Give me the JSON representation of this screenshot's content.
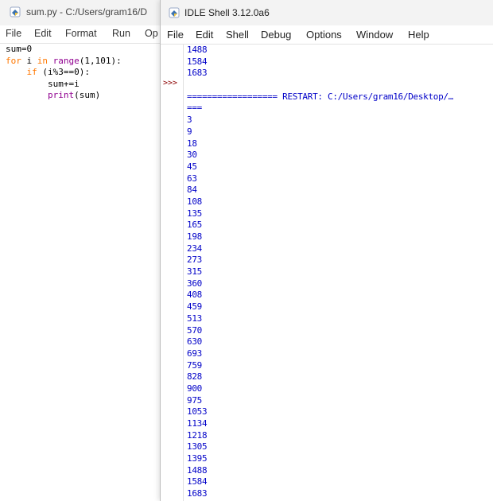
{
  "editor": {
    "title": "sum.py - C:/Users/gram16/D",
    "menu": [
      "File",
      "Edit",
      "Format",
      "Run",
      "Op"
    ],
    "code": [
      {
        "parts": [
          {
            "t": "sum=0",
            "c": "tx"
          }
        ]
      },
      {
        "parts": [
          {
            "t": "for",
            "c": "kw"
          },
          {
            "t": " i ",
            "c": "tx"
          },
          {
            "t": "in",
            "c": "kw"
          },
          {
            "t": " ",
            "c": "tx"
          },
          {
            "t": "range",
            "c": "bi"
          },
          {
            "t": "(1,101):",
            "c": "tx"
          }
        ]
      },
      {
        "parts": [
          {
            "t": "    ",
            "c": "tx"
          },
          {
            "t": "if",
            "c": "kw"
          },
          {
            "t": " (i%3==0):",
            "c": "tx"
          }
        ]
      },
      {
        "parts": [
          {
            "t": "        sum+=i",
            "c": "tx"
          }
        ]
      },
      {
        "parts": [
          {
            "t": "        ",
            "c": "tx"
          },
          {
            "t": "print",
            "c": "bi"
          },
          {
            "t": "(sum)",
            "c": "tx"
          }
        ]
      }
    ]
  },
  "shell": {
    "title": "IDLE Shell 3.12.0a6",
    "menu": [
      "File",
      "Edit",
      "Shell",
      "Debug",
      "Options",
      "Window",
      "Help"
    ],
    "prompt": ">>>",
    "output_top": [
      "1488",
      "1584",
      "1683",
      ""
    ],
    "restart_line": "================== RESTART: C:/Users/gram16/Desktop/…",
    "restart_cont": "===",
    "output": [
      "3",
      "9",
      "18",
      "30",
      "45",
      "63",
      "84",
      "108",
      "135",
      "165",
      "198",
      "234",
      "273",
      "315",
      "360",
      "408",
      "459",
      "513",
      "570",
      "630",
      "693",
      "759",
      "828",
      "900",
      "975",
      "1053",
      "1134",
      "1218",
      "1305",
      "1395",
      "1488",
      "1584",
      "1683"
    ]
  },
  "colors": {
    "keyword": "#ff7700",
    "builtin": "#900090",
    "output": "#0000c8",
    "prompt": "#8b0000"
  }
}
